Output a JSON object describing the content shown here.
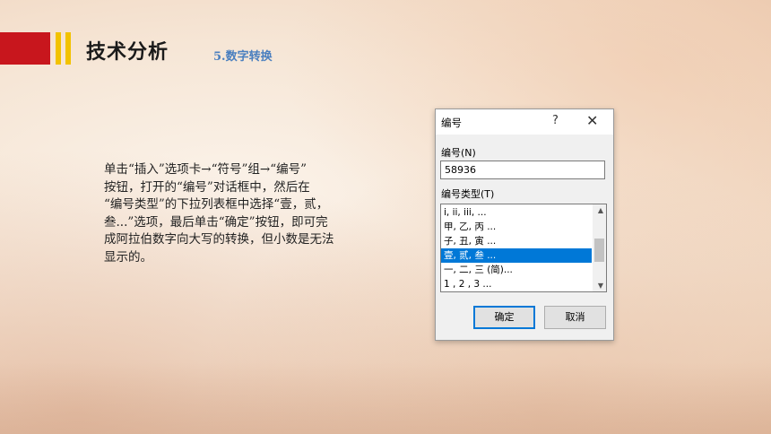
{
  "slide": {
    "title": "技术分析",
    "subtitle": "5.数字转换",
    "body": "单击“插入”选项卡→“符号”组→“编号”\n按钮，打开的“编号”对话框中，然后在\n“编号类型”的下拉列表框中选择“壹，贰，\n叁...”选项，最后单击“确定”按钮，即可完\n成阿拉伯数字向大写的转换，但小数是无法\n显示的。"
  },
  "dialog": {
    "title": "编号",
    "help_glyph": "?",
    "close_glyph": "✕",
    "number_label": "编号(N)",
    "number_value": "58936",
    "type_label": "编号类型(T)",
    "type_options": [
      "i, ii, iii, ...",
      "甲, 乙, 丙 ...",
      "子, 丑, 寅 ...",
      "壹, 贰, 叁 ...",
      "一, 二, 三 (简)...",
      "1 , 2 , 3  ..."
    ],
    "selected_index": 3,
    "ok_label": "确定",
    "cancel_label": "取消"
  },
  "colors": {
    "accent_red": "#c8161d",
    "accent_yellow": "#f2c200",
    "subtitle_blue": "#4a7fbf",
    "selection_blue": "#0078d7"
  }
}
